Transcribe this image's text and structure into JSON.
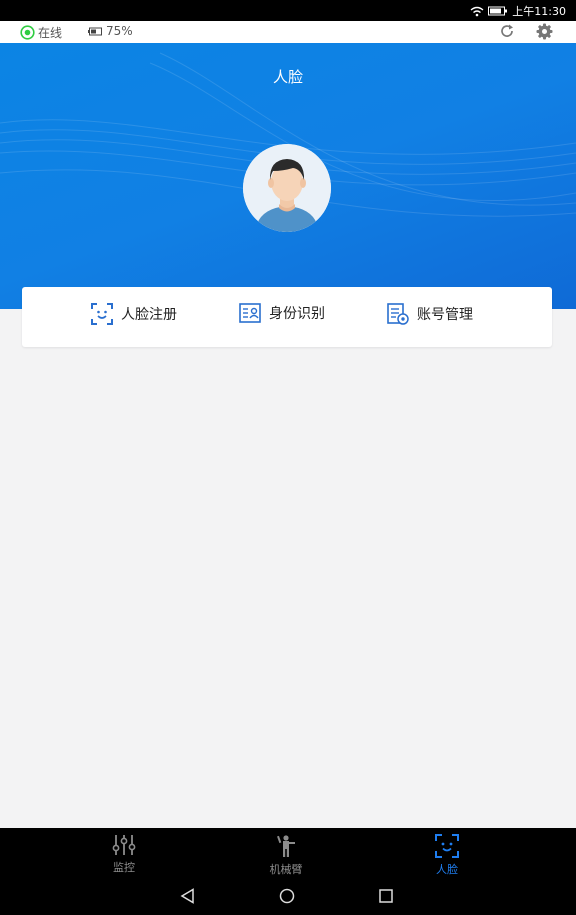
{
  "status_bar": {
    "time": "上午11:30"
  },
  "app_bar": {
    "online_label": "在线",
    "battery_label": "75%"
  },
  "hero": {
    "title": "人脸"
  },
  "menu": [
    {
      "label": "人脸注册",
      "icon": "face-register-icon"
    },
    {
      "label": "身份识别",
      "icon": "id-card-icon"
    },
    {
      "label": "账号管理",
      "icon": "account-manage-icon"
    }
  ],
  "bottom_nav": [
    {
      "label": "监控",
      "icon": "sliders-icon",
      "active": false
    },
    {
      "label": "机械臂",
      "icon": "robot-arm-icon",
      "active": false
    },
    {
      "label": "人脸",
      "icon": "face-scan-icon",
      "active": true
    }
  ],
  "colors": {
    "accent": "#1f7ef0",
    "hero": "#0b84e4",
    "online": "#2ecc40"
  }
}
